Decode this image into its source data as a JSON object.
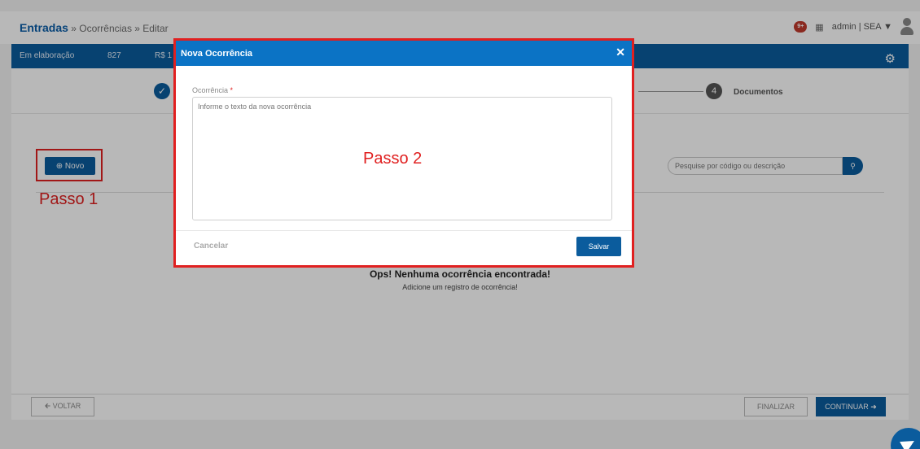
{
  "header": {
    "breadcrumb_main": "Entradas",
    "breadcrumb_rest": " » Ocorrências » Editar",
    "notification_count": "9+",
    "user_menu": "admin | SEA"
  },
  "summary_bar": {
    "status": "Em elaboração",
    "number": "827",
    "amount_prefix": "R$ 1"
  },
  "stepper": {
    "step4_number": "4",
    "step4_label": "Documentos"
  },
  "toolbar": {
    "new_button": "Novo",
    "search_placeholder": "Pesquise por código ou descrição"
  },
  "annotations": {
    "step1": "Passo 1",
    "step2": "Passo 2"
  },
  "empty_state": {
    "title": "Ops! Nenhuma ocorrência encontrada!",
    "subtitle": "Adicione um registro de ocorrência!"
  },
  "footer": {
    "back": "VOLTAR",
    "finish": "FINALIZAR",
    "continue": "CONTINUAR"
  },
  "modal": {
    "title": "Nova Ocorrência",
    "field_label": "Ocorrência",
    "required_mark": "*",
    "textarea_placeholder": "Informe o texto da nova ocorrência",
    "cancel": "Cancelar",
    "save": "Salvar"
  },
  "icons": {
    "close": "close-icon",
    "check": "check-icon",
    "gear": "gear-icon",
    "search": "search-icon",
    "plus": "plus-circle-icon"
  },
  "colors": {
    "primary": "#0b5c9d",
    "modal_header": "#0b73c5",
    "annotation_red": "#e02020"
  }
}
